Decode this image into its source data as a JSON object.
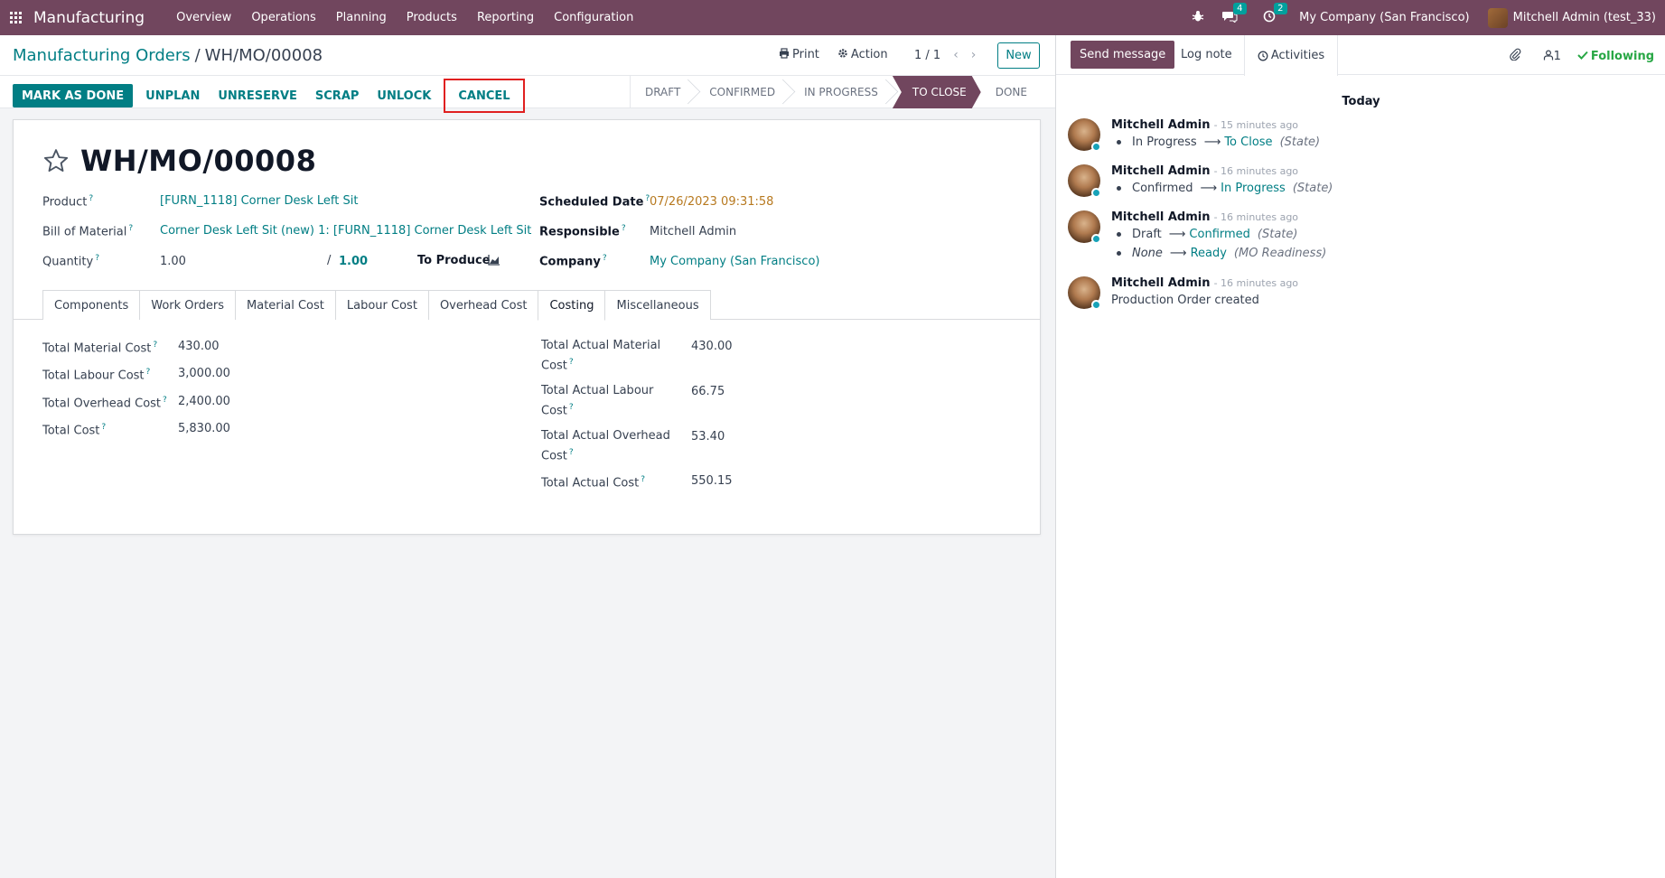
{
  "navbar": {
    "app_name": "Manufacturing",
    "menu": [
      "Overview",
      "Operations",
      "Planning",
      "Products",
      "Reporting",
      "Configuration"
    ],
    "messages_badge": "4",
    "activities_badge": "2",
    "company": "My Company (San Francisco)",
    "user": "Mitchell Admin (test_33)"
  },
  "control": {
    "breadcrumb_parent": "Manufacturing Orders",
    "breadcrumb_sep": "/",
    "breadcrumb_current": "WH/MO/00008",
    "print_label": "Print",
    "action_label": "Action",
    "pager": "1 / 1",
    "new_label": "New"
  },
  "statusbar": {
    "buttons": [
      "MARK AS DONE",
      "UNPLAN",
      "UNRESERVE",
      "SCRAP",
      "UNLOCK",
      "CANCEL"
    ],
    "stages": [
      "DRAFT",
      "CONFIRMED",
      "IN PROGRESS",
      "TO CLOSE",
      "DONE"
    ],
    "active_stage": "TO CLOSE"
  },
  "form": {
    "title": "WH/MO/00008",
    "product_label": "Product",
    "product_value": "[FURN_1118] Corner Desk Left Sit",
    "bom_label": "Bill of Material",
    "bom_value": "Corner Desk Left Sit (new) 1: [FURN_1118] Corner Desk Left Sit",
    "quantity_label": "Quantity",
    "quantity_value": "1.00",
    "quantity_slash": "/",
    "quantity_producing": "1.00",
    "to_produce_label": "To Produce",
    "scheduled_label": "Scheduled Date",
    "scheduled_value": "07/26/2023 09:31:58",
    "responsible_label": "Responsible",
    "responsible_value": "Mitchell Admin",
    "company_label": "Company",
    "company_value": "My Company (San Francisco)",
    "question_mark": "?",
    "tabs": [
      "Components",
      "Work Orders",
      "Material Cost",
      "Labour Cost",
      "Overhead Cost",
      "Costing",
      "Miscellaneous"
    ],
    "active_tab": "Costing"
  },
  "costing": {
    "left": [
      {
        "label": "Total Material Cost",
        "value": "430.00"
      },
      {
        "label": "Total Labour Cost",
        "value": "3,000.00"
      },
      {
        "label": "Total Overhead Cost",
        "value": "2,400.00"
      },
      {
        "label": "Total Cost",
        "value": "5,830.00"
      }
    ],
    "right": [
      {
        "label1": "Total Actual Material",
        "label2": "Cost",
        "value": "430.00"
      },
      {
        "label1": "Total Actual Labour",
        "label2": "Cost",
        "value": "66.75"
      },
      {
        "label1": "Total Actual Overhead",
        "label2": "Cost",
        "value": "53.40"
      },
      {
        "label1": "Total Actual Cost",
        "label2": "",
        "value": "550.15"
      }
    ]
  },
  "chatter": {
    "send_message": "Send message",
    "log_note": "Log note",
    "activities": "Activities",
    "followers_count": "1",
    "following": "Following",
    "today": "Today",
    "messages": [
      {
        "author": "Mitchell Admin",
        "time": "- 15 minutes ago",
        "old": "In Progress",
        "new": "To Close",
        "field": "(State)"
      },
      {
        "author": "Mitchell Admin",
        "time": "- 16 minutes ago",
        "old": "Confirmed",
        "new": "In Progress",
        "field": "(State)"
      },
      {
        "author": "Mitchell Admin",
        "time": "- 16 minutes ago",
        "old": "Draft",
        "new": "Confirmed",
        "field": "(State)",
        "old2": "None",
        "new2": "Ready",
        "field2": "(MO Readiness)"
      },
      {
        "author": "Mitchell Admin",
        "time": "- 16 minutes ago",
        "text": "Production Order created"
      }
    ]
  },
  "colors": {
    "brand": "#71465e",
    "accent": "#017e84",
    "following": "#28a745",
    "highlight_border": "#e02020"
  }
}
